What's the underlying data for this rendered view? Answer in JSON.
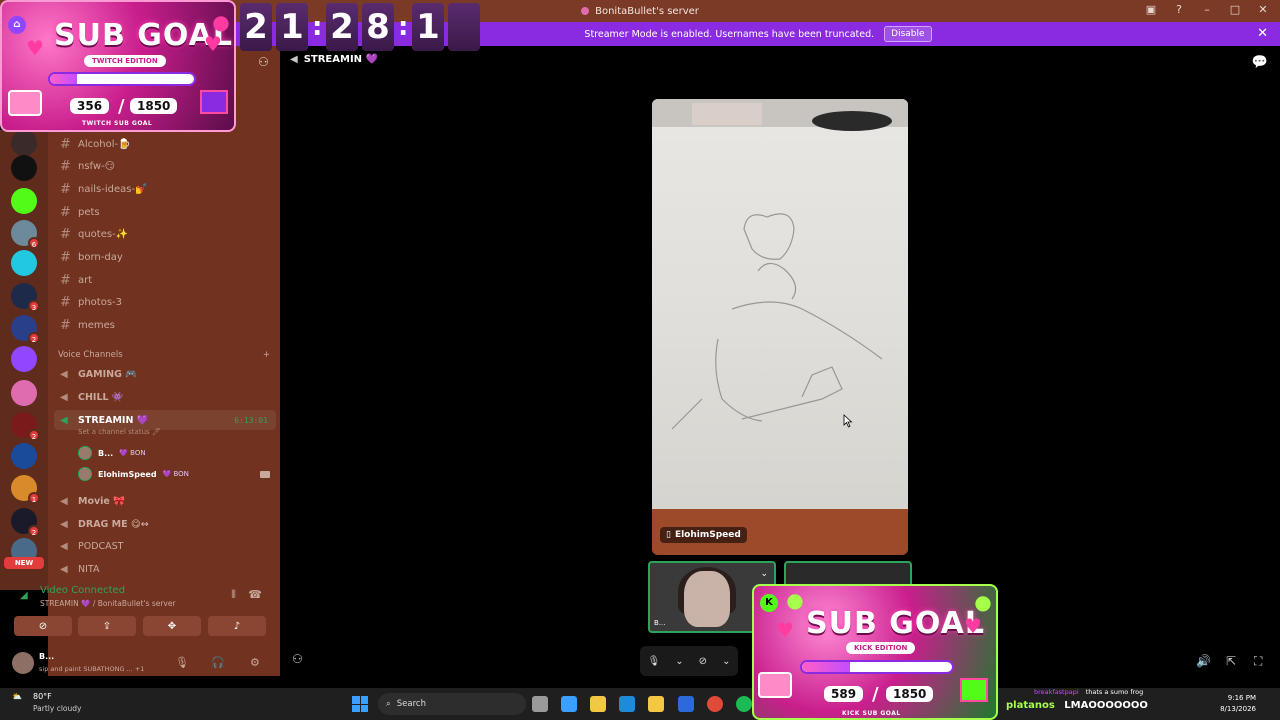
{
  "window": {
    "title": "BonitaBullet's server"
  },
  "banner": {
    "text": "Streamer Mode is enabled. Usernames have been truncated.",
    "disable_label": "Disable"
  },
  "countdown": {
    "digits": [
      "2",
      "1",
      "2",
      "8",
      "1"
    ],
    "sep": ":"
  },
  "sub_goal_twitch": {
    "title": "SUB GOAL",
    "edition": "TWITCH EDITION",
    "current": "356",
    "goal": "1850",
    "progress": 0.19,
    "footer": "TWITCH SUB GOAL"
  },
  "sub_goal_kick": {
    "title": "SUB GOAL",
    "edition": "KICK EDITION",
    "current": "589",
    "goal": "1850",
    "progress": 0.32,
    "footer": "KICK SUB GOAL"
  },
  "rail": {
    "badges": [
      "6",
      "3",
      "2",
      "2",
      "1",
      "2"
    ],
    "new_label": "NEW"
  },
  "text_channels": [
    {
      "name": "Alcohol-🍺"
    },
    {
      "name": "nsfw-😏"
    },
    {
      "name": "nails-ideas-💅"
    },
    {
      "name": "pets"
    },
    {
      "name": "quotes-✨"
    },
    {
      "name": "born-day"
    },
    {
      "name": "art"
    },
    {
      "name": "photos-3"
    },
    {
      "name": "memes"
    }
  ],
  "voice_section": {
    "label": "Voice Channels"
  },
  "voice_channels": [
    {
      "name": "GAMING 🎮"
    },
    {
      "name": "CHILL 👾"
    },
    {
      "name": "STREAMIN 💜",
      "timer": "6:13:01",
      "status": "Set a channel status 🖊"
    },
    {
      "name": "Movie 🎀"
    },
    {
      "name": "DRAG ME 😋↔"
    },
    {
      "name": "PODCAST"
    },
    {
      "name": "NITA"
    }
  ],
  "members": [
    {
      "name": "B...",
      "tag": "💜 BON"
    },
    {
      "name": "ElohimSpeed",
      "tag": "💜 BON"
    }
  ],
  "voice_connected": {
    "status": "Video Connected",
    "sub": "STREAMIN 💜 / BonitaBullet's server"
  },
  "user": {
    "name": "B...",
    "status": "sip and paint SUBATHONG ... +1"
  },
  "main": {
    "channel_name": "STREAMIN 💜",
    "video_name": "ElohimSpeed",
    "tile_label": "B..."
  },
  "chat": {
    "line1_user": "breakfastpapi",
    "line1_text": "thats a sumo frog",
    "line2_user": "platanos",
    "line2_text": "LMAOOOOOOO"
  },
  "taskbar": {
    "temp": "80°F",
    "weather": "Partly cloudy",
    "search": "Search",
    "time": "9:16 PM",
    "date": "8/13/2026"
  },
  "colors": {
    "sidebar": "#71321f",
    "banner": "#8a2be2",
    "connected": "#2ea35a"
  }
}
